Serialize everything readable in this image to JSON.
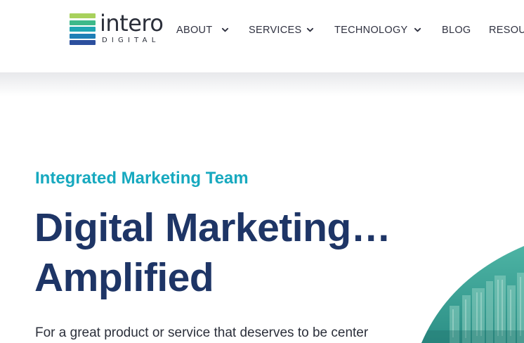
{
  "header": {
    "logo": {
      "word": "intero",
      "subword": "DIGITAL",
      "bar_colors": [
        "#a8d15c",
        "#3db98a",
        "#1fa6b2",
        "#1f7fb6",
        "#2c4f9e"
      ]
    },
    "nav": [
      {
        "label": "ABOUT",
        "has_dropdown": true,
        "icon": "chevron-down-icon"
      },
      {
        "label": "SERVICES",
        "has_dropdown": true,
        "icon": "chevron-down-icon"
      },
      {
        "label": "TECHNOLOGY",
        "has_dropdown": true,
        "icon": "chevron-down-icon"
      },
      {
        "label": "BLOG",
        "has_dropdown": false
      },
      {
        "label": "RESOU",
        "has_dropdown": false
      }
    ]
  },
  "hero": {
    "eyebrow": "Integrated Marketing Team",
    "headline_line1": "Digital Marketing…",
    "headline_line2": "Amplified",
    "intro": "For a great product or service that deserves to be center",
    "image_icon": "city-skyline-image"
  },
  "colors": {
    "accent": "#17a9bf",
    "headline": "#1e3566",
    "text": "#2b2f3a",
    "teal_overlay": "#2f9f93"
  }
}
